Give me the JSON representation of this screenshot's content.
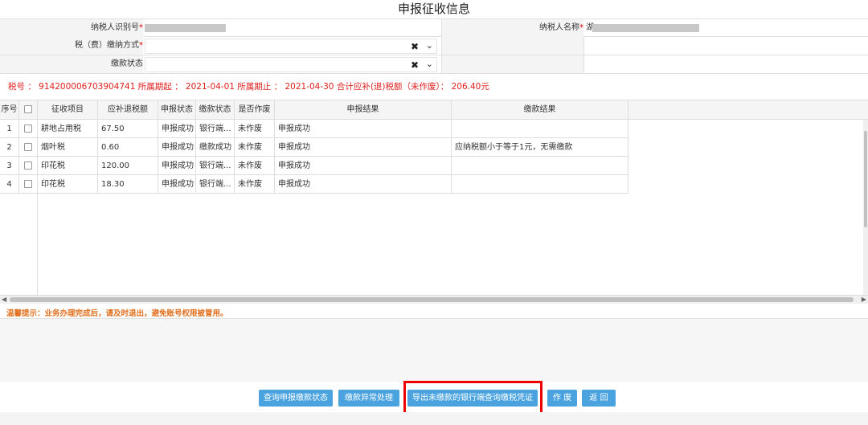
{
  "title": "申报征收信息",
  "form": {
    "taxpayer_id_label": "纳税人识别号",
    "taxpayer_name_label": "纳税人名称",
    "taxpayer_name_value": "湖",
    "payment_method_label": "税（费）缴纳方式",
    "payment_status_label": "缴款状态",
    "required_mark": "*",
    "clear_glyph": "✖",
    "chevron_glyph": "⌄"
  },
  "summary": "税号 ：  914200006703904741    所属期起 ：  2021-04-01    所属期止 ：  2021-04-30    合计应补(退)税额（未作废）：  206.40元",
  "table": {
    "headers": [
      "序号",
      "",
      "征收项目",
      "应补退税额",
      "申报状态",
      "缴款状态",
      "是否作废",
      "申报结果",
      "缴款结果"
    ],
    "rows": [
      {
        "no": "1",
        "item": "耕地占用税",
        "amount": "67.50",
        "decl_status": "申报成功",
        "pay_status": "银行端...",
        "voided": "未作废",
        "decl_result": "申报成功",
        "pay_result": ""
      },
      {
        "no": "2",
        "item": "烟叶税",
        "amount": "0.60",
        "decl_status": "申报成功",
        "pay_status": "缴款成功",
        "voided": "未作废",
        "decl_result": "申报成功",
        "pay_result": "应纳税额小于等于1元，无需缴款"
      },
      {
        "no": "3",
        "item": "印花税",
        "amount": "120.00",
        "decl_status": "申报成功",
        "pay_status": "银行端...",
        "voided": "未作废",
        "decl_result": "申报成功",
        "pay_result": ""
      },
      {
        "no": "4",
        "item": "印花税",
        "amount": "18.30",
        "decl_status": "申报成功",
        "pay_status": "银行端...",
        "voided": "未作废",
        "decl_result": "申报成功",
        "pay_result": ""
      }
    ]
  },
  "tip": "温馨提示：业务办理完成后，请及时退出，避免账号权限被冒用。",
  "buttons": {
    "query_status": "查询申报缴款状态",
    "payment_exception": "缴款异常处理",
    "export_voucher": "导出未缴款的银行端查询缴税凭证",
    "void": "作 废",
    "back": "返 回"
  },
  "colors": {
    "button": "#4aa3df",
    "summary_text": "#e02020",
    "tip_text": "#e07020",
    "highlight_border": "#e00000"
  }
}
